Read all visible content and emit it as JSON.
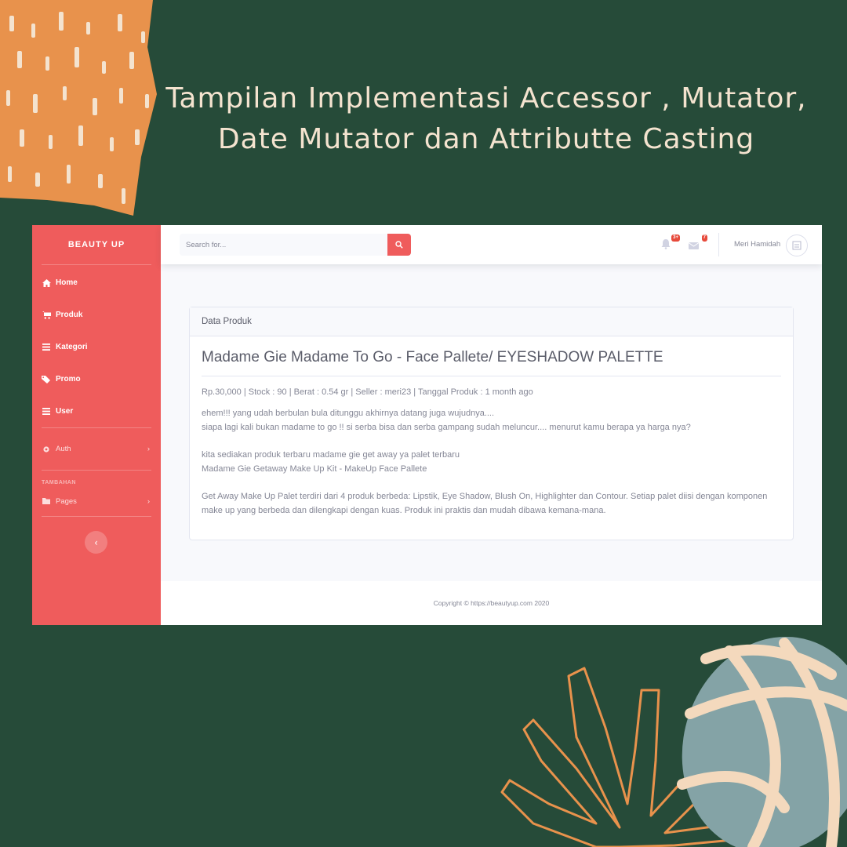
{
  "slide": {
    "title_line1": "Tampilan Implementasi Accessor , Mutator,",
    "title_line2": "Date Mutator dan Attributte Casting",
    "colors": {
      "background": "#264b39",
      "orange": "#e8924c",
      "cream": "#f4e3cf",
      "teal": "#84a3a6"
    }
  },
  "app": {
    "brand": "BEAUTY UP",
    "colors": {
      "sidebar": "#ef5c5c",
      "accent": "#ef5c5c",
      "badge": "#e74a3b"
    },
    "sidebar": {
      "items": [
        {
          "label": "Home",
          "icon": "home-icon"
        },
        {
          "label": "Produk",
          "icon": "cart-icon"
        },
        {
          "label": "Kategori",
          "icon": "bars-icon"
        },
        {
          "label": "Promo",
          "icon": "tags-icon"
        },
        {
          "label": "User",
          "icon": "bars-icon"
        }
      ],
      "auth": {
        "label": "Auth",
        "icon": "cog-icon"
      },
      "section_heading": "TAMBAHAN",
      "pages": {
        "label": "Pages",
        "icon": "folder-icon"
      },
      "toggle_icon": "chevron-left-icon"
    },
    "topbar": {
      "search_placeholder": "Search for...",
      "search_icon": "search-icon",
      "alerts_badge": "3+",
      "messages_badge": "7",
      "user_name": "Meri Hamidah"
    },
    "card": {
      "header": "Data Produk",
      "product_title": "Madame Gie Madame To Go - Face Pallete/ EYESHADOW PALETTE",
      "meta": "Rp.30,000 | Stock : 90 | Berat : 0.54 gr | Seller : meri23 | Tanggal Produk : 1 month ago",
      "desc1": "ehem!!! yang udah berbulan bula ditunggu akhirnya datang juga wujudnya....",
      "desc2": "siapa lagi kali bukan madame to go !! si serba bisa dan serba gampang sudah meluncur.... menurut kamu berapa ya harga nya?",
      "desc3": "kita sediakan produk terbaru madame gie get away ya palet terbaru",
      "desc4": "Madame Gie Getaway Make Up Kit - MakeUp Face Pallete",
      "desc5": "Get Away Make Up Palet terdiri dari 4 produk berbeda: Lipstik, Eye Shadow, Blush On, Highlighter dan Contour. Setiap palet diisi dengan komponen make up yang berbeda dan dilengkapi dengan kuas. Produk ini praktis dan mudah dibawa kemana-mana."
    },
    "footer": "Copyright © https://beautyup.com 2020"
  }
}
